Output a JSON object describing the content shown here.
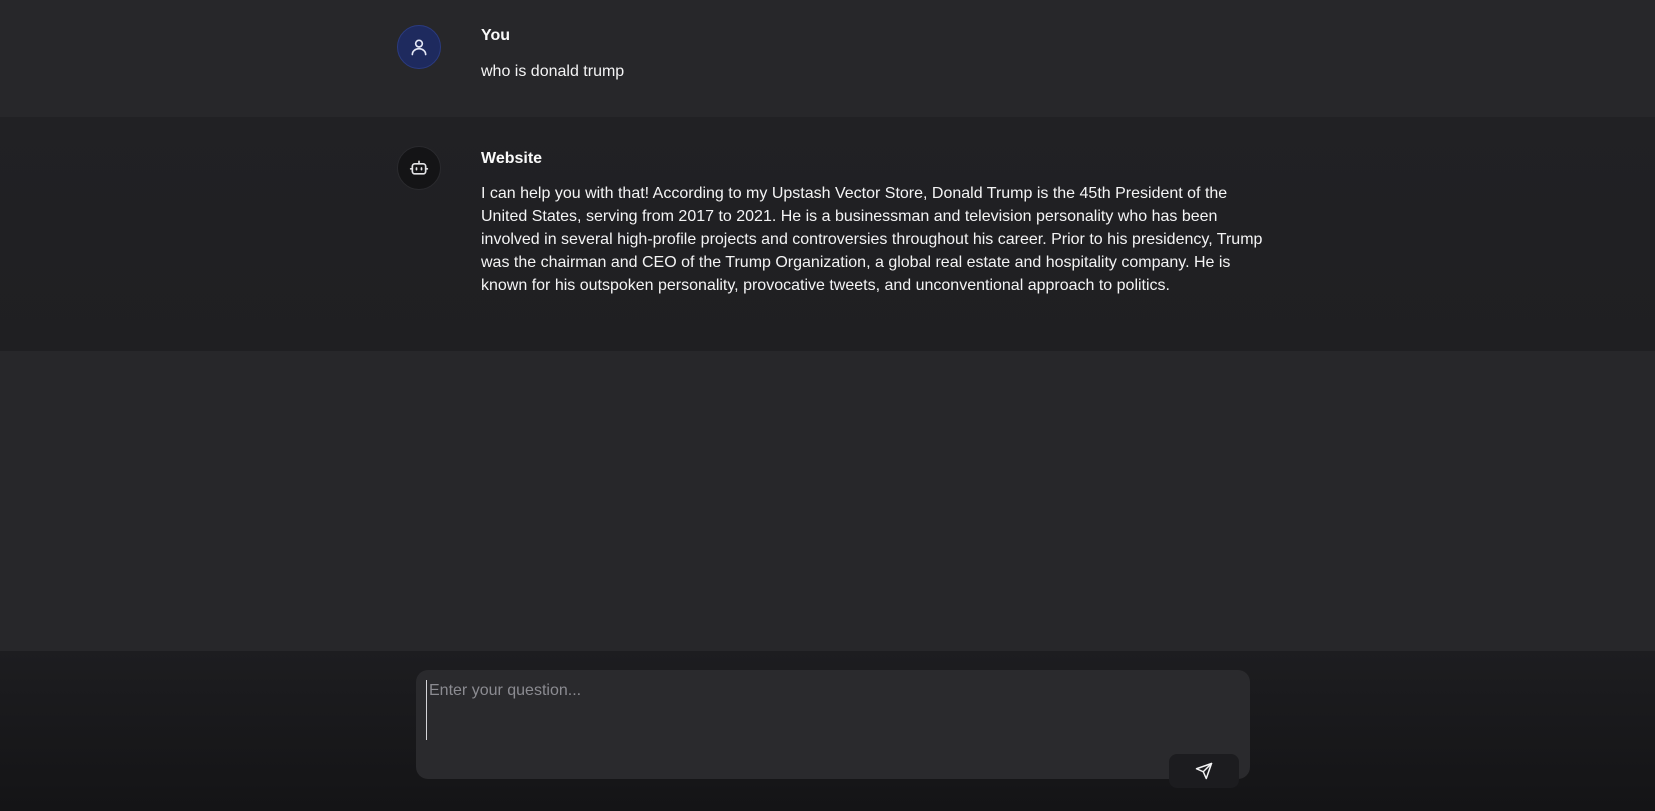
{
  "conversation": {
    "messages": [
      {
        "role": "user",
        "sender": "You",
        "avatar_icon": "user-icon",
        "text": "who is donald trump"
      },
      {
        "role": "assistant",
        "sender": "Website",
        "avatar_icon": "bot-icon",
        "text": "I can help you with that! According to my Upstash Vector Store, Donald Trump is the 45th President of the United States, serving from 2017 to 2021. He is a businessman and television personality who has been involved in several high-profile projects and controversies throughout his career. Prior to his presidency, Trump was the chairman and CEO of the Trump Organization, a global real estate and hospitality company. He is known for his outspoken personality, provocative tweets, and unconventional approach to politics."
      }
    ]
  },
  "composer": {
    "value": "",
    "placeholder": "Enter your question...",
    "send_icon": "send-icon"
  },
  "colors": {
    "background": "#27272a",
    "assistant_row": "#212124",
    "user_avatar": "#1e2a5e",
    "bot_avatar": "#141416",
    "input_bg": "#2a2a2d",
    "text": "#f4f4f5"
  }
}
